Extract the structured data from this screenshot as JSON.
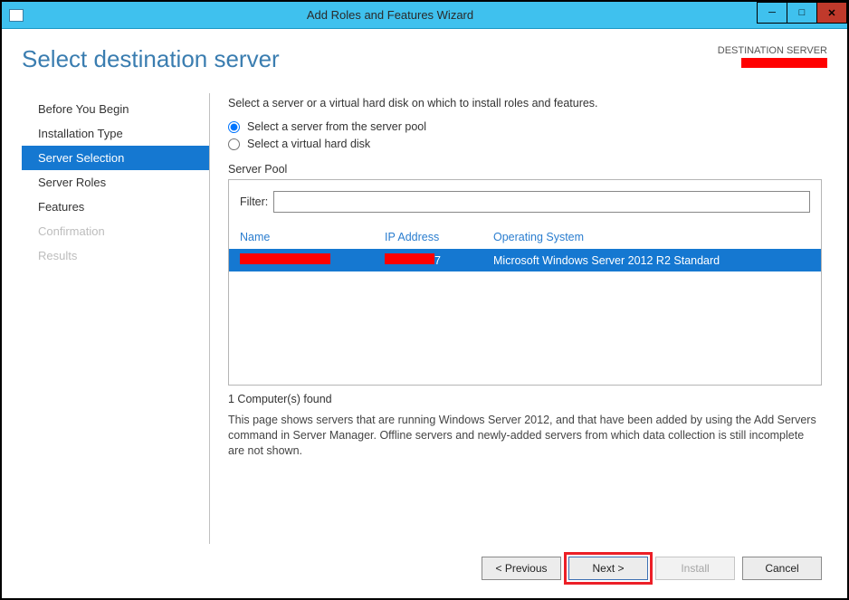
{
  "window": {
    "title": "Add Roles and Features Wizard"
  },
  "page_title": "Select destination server",
  "destination": {
    "label": "DESTINATION SERVER",
    "value_redacted": true
  },
  "sidebar": {
    "items": [
      {
        "label": "Before You Begin",
        "state": "normal"
      },
      {
        "label": "Installation Type",
        "state": "normal"
      },
      {
        "label": "Server Selection",
        "state": "active"
      },
      {
        "label": "Server Roles",
        "state": "normal"
      },
      {
        "label": "Features",
        "state": "normal"
      },
      {
        "label": "Confirmation",
        "state": "disabled"
      },
      {
        "label": "Results",
        "state": "disabled"
      }
    ]
  },
  "main": {
    "intro": "Select a server or a virtual hard disk on which to install roles and features.",
    "radios": {
      "pool": "Select a server from the server pool",
      "vhd": "Select a virtual hard disk",
      "selected": "pool"
    },
    "server_pool_label": "Server Pool",
    "filter_label": "Filter:",
    "filter_value": "",
    "columns": {
      "name": "Name",
      "ip": "IP Address",
      "os": "Operating System"
    },
    "rows": [
      {
        "name_redacted": true,
        "name_suffix": "",
        "ip_redacted": true,
        "ip_suffix": "7",
        "os": "Microsoft Windows Server 2012 R2 Standard",
        "selected": true
      }
    ],
    "count_text": "1 Computer(s) found",
    "info": "This page shows servers that are running Windows Server 2012, and that have been added by using the Add Servers command in Server Manager. Offline servers and newly-added servers from which data collection is still incomplete are not shown."
  },
  "buttons": {
    "previous": "< Previous",
    "next": "Next >",
    "install": "Install",
    "cancel": "Cancel"
  }
}
